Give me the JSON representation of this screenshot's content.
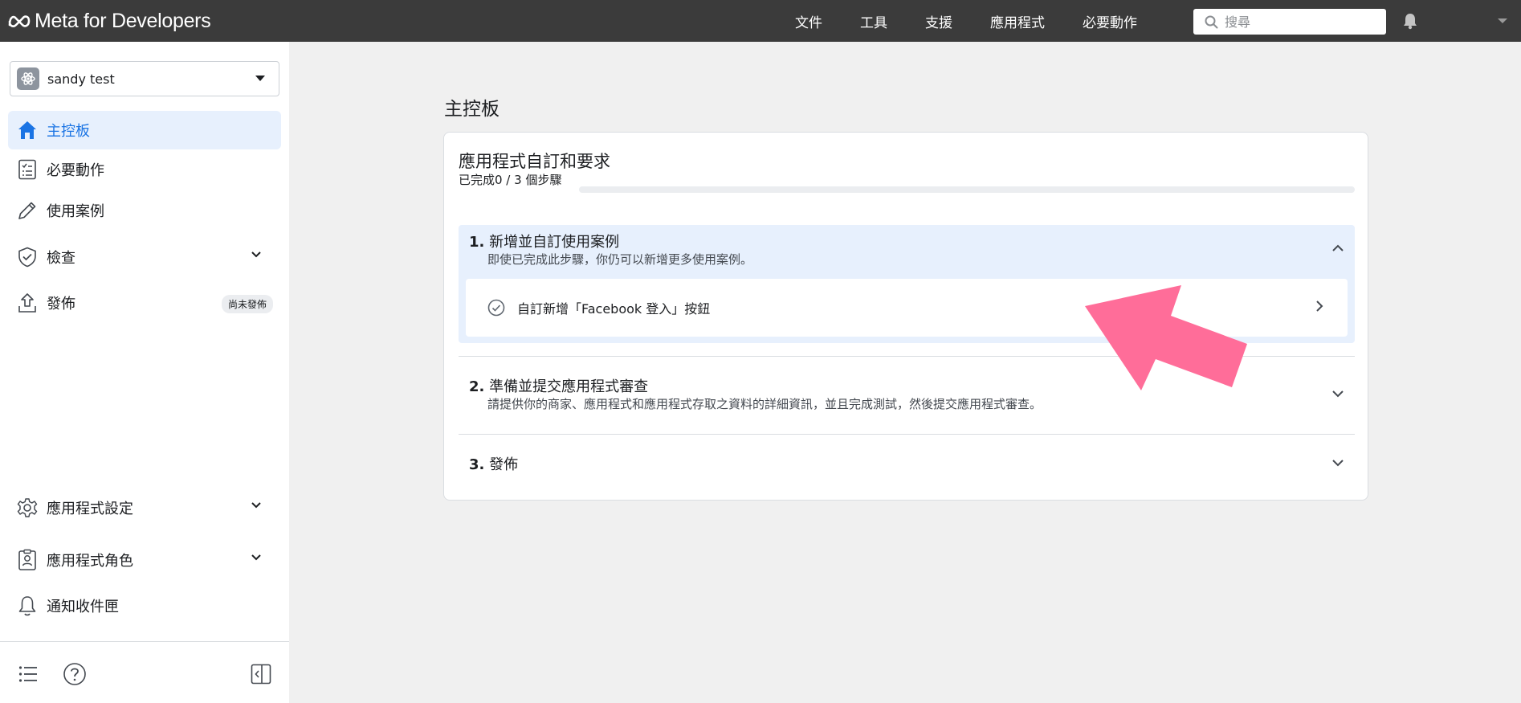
{
  "header": {
    "logo_text": "Meta for Developers",
    "nav": [
      "文件",
      "工具",
      "支援",
      "應用程式",
      "必要動作"
    ],
    "search_placeholder": "搜尋"
  },
  "sidebar": {
    "app_name": "sandy test",
    "items": [
      {
        "label": "主控板",
        "icon": "home-icon",
        "active": true
      },
      {
        "label": "必要動作",
        "icon": "checklist-icon"
      },
      {
        "label": "使用案例",
        "icon": "pencil-icon"
      },
      {
        "label": "檢查",
        "icon": "shield-check-icon",
        "expandable": true
      },
      {
        "label": "發佈",
        "icon": "upload-icon",
        "badge": "尚未發佈"
      },
      {
        "label": "應用程式設定",
        "icon": "gear-icon",
        "expandable": true
      },
      {
        "label": "應用程式角色",
        "icon": "id-badge-icon",
        "expandable": true
      },
      {
        "label": "通知收件匣",
        "icon": "bell-icon"
      }
    ],
    "bottom_icons": [
      "list-icon",
      "help-icon",
      "collapse-panel-icon"
    ]
  },
  "main": {
    "page_title": "主控板",
    "card": {
      "title": "應用程式自訂和要求",
      "progress_text": "已完成0 / 3 個步驟",
      "progress_fraction": 0,
      "steps": [
        {
          "number": "1.",
          "title": "新增並自訂使用案例",
          "description": "即使已完成此步驟，你仍可以新增更多使用案例。",
          "expanded": true,
          "tasks": [
            {
              "label": "自訂新增「Facebook 登入」按鈕"
            }
          ]
        },
        {
          "number": "2.",
          "title": "準備並提交應用程式審查",
          "description": "請提供你的商家、應用程式和應用程式存取之資料的詳細資訊，並且完成測試，然後提交應用程式審查。",
          "expanded": false
        },
        {
          "number": "3.",
          "title": "發佈",
          "expanded": false
        }
      ]
    }
  },
  "colors": {
    "topbar": "#3b3b3b",
    "accent": "#1b74e4",
    "active_bg": "#e7f0fd",
    "annotation_arrow": "#ff6d99"
  }
}
